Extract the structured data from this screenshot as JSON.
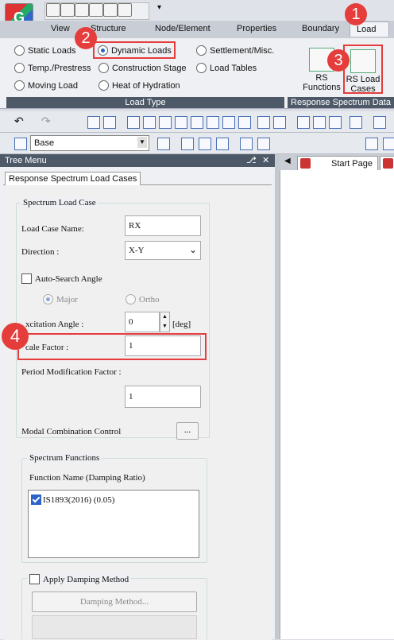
{
  "ribbon_tabs": [
    "View",
    "Structure",
    "Node/Element",
    "Properties",
    "Boundary",
    "Load"
  ],
  "load_types": {
    "static_loads": "Static Loads",
    "dynamic_loads": "Dynamic Loads",
    "settlement": "Settlement/Misc.",
    "temp_prestress": "Temp./Prestress",
    "construction_stage": "Construction Stage",
    "load_tables": "Load Tables",
    "moving_load": "Moving Load",
    "heat_of_hydration": "Heat of Hydration",
    "group_label": "Load Type",
    "selected": "Dynamic Loads"
  },
  "response_spectrum": {
    "rs_functions_line1": "RS",
    "rs_functions_line2": "Functions",
    "rs_load_cases_line1": "RS Load",
    "rs_load_cases_line2": "Cases",
    "group_label": "Response Spectrum Data"
  },
  "toolbar": {
    "base_select": "Base"
  },
  "tree_menu": {
    "title": "Tree Menu",
    "pin_glyph": " ❖",
    "close_glyph": "✕"
  },
  "panel": {
    "tab": "Response Spectrum Load Cases",
    "spectrum_load_case_legend": "Spectrum Load Case",
    "load_case_name_label": "Load Case Name:",
    "load_case_name_value": "RX",
    "direction_label": "Direction :",
    "direction_value": "X-Y",
    "auto_search_label": "Auto-Search Angle",
    "major_label": "Major",
    "ortho_label": "Ortho",
    "excitation_label": "xcitation Angle :",
    "excitation_value": "0",
    "excitation_unit": "[deg]",
    "scale_label": "cale Factor :",
    "scale_value": "1",
    "period_label": "Period Modification Factor :",
    "period_value": "1",
    "modal_label": "Modal Combination Control",
    "modal_button": "...",
    "spectrum_functions_legend": "Spectrum Functions",
    "function_header": "Function Name (Damping Ratio)",
    "functions": [
      "IS1893(2016) (0.05)"
    ],
    "apply_damping_label": "Apply Damping Method",
    "damping_button": "Damping Method..."
  },
  "doc_tabs": {
    "start_page": "Start Page"
  },
  "callouts": [
    "1",
    "2",
    "3",
    "4"
  ],
  "colors": {
    "callout": "#e53c3c",
    "header_dark": "#4d5967",
    "accent_blue": "#2b63c7"
  }
}
